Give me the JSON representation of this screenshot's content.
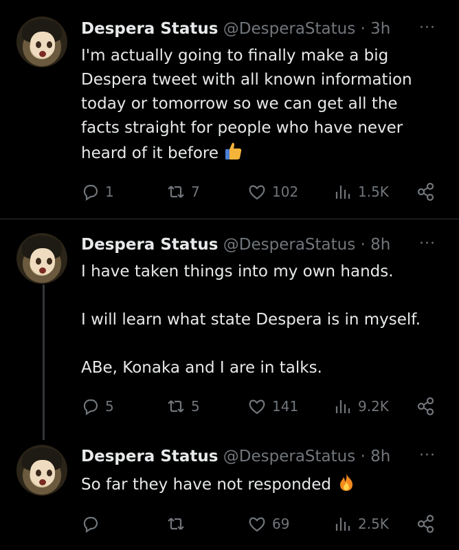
{
  "tweets": [
    {
      "name": "Despera Status",
      "handle": "@DesperaStatus",
      "time": "· 3h",
      "more": "···",
      "text": "I'm actually going to finally make a big Despera tweet with all known information today or tomorrow so we can get all the facts straight for people who have never heard of it before",
      "emoji": "thumbs-up",
      "replies": "1",
      "retweets": "7",
      "likes": "102",
      "views": "1.5K"
    },
    {
      "name": "Despera Status",
      "handle": "@DesperaStatus",
      "time": "· 8h",
      "more": "···",
      "text": "I have taken things into my own hands.\n\nI will learn what state Despera is in myself.\n\nABe, Konaka and I are in talks.",
      "replies": "5",
      "retweets": "5",
      "likes": "141",
      "views": "9.2K"
    },
    {
      "name": "Despera Status",
      "handle": "@DesperaStatus",
      "time": "· 8h",
      "more": "···",
      "text": "So far they have not responded",
      "emoji": "fire",
      "replies": "",
      "retweets": "",
      "likes": "69",
      "views": "2.5K"
    }
  ],
  "colors": {
    "background": "#000000",
    "text": "#e7e9ea",
    "muted": "#71767b",
    "divider": "#2f3336"
  }
}
